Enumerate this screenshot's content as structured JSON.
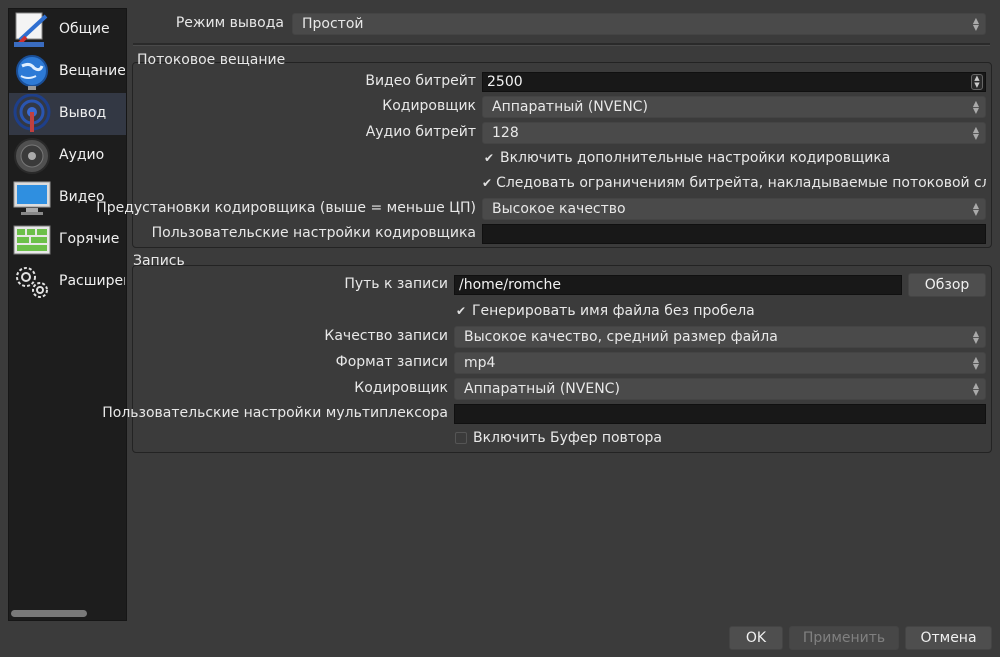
{
  "sidebar": {
    "items": [
      {
        "label": "Общие",
        "icon": "general-settings-icon"
      },
      {
        "label": "Вещание",
        "icon": "stream-globe-icon"
      },
      {
        "label": "Вывод",
        "icon": "output-antenna-icon"
      },
      {
        "label": "Аудио",
        "icon": "speaker-icon"
      },
      {
        "label": "Видео",
        "icon": "monitor-icon"
      },
      {
        "label": "Горячие к...",
        "icon": "keyboard-icon"
      },
      {
        "label": "Расширен...",
        "icon": "gears-icon"
      }
    ],
    "active": "Вывод"
  },
  "output_mode": {
    "label": "Режим вывода",
    "value": "Простой"
  },
  "streaming": {
    "title": "Потоковое вещание",
    "video_bitrate": {
      "label": "Видео битрейт",
      "value": "2500"
    },
    "encoder": {
      "label": "Кодировщик",
      "value": "Аппаратный (NVENC)"
    },
    "audio_bitrate": {
      "label": "Аудио битрейт",
      "value": "128"
    },
    "advanced_check": {
      "label": "Включить дополнительные настройки кодировщика",
      "checked": true
    },
    "enforce_check": {
      "label": "Следовать ограничениям битрейта, накладываемые потоковой службой",
      "checked": true
    },
    "preset": {
      "label": "Предустановки кодировщика (выше = меньше ЦП)",
      "value": "Высокое качество"
    },
    "custom_settings": {
      "label": "Пользовательские настройки кодировщика",
      "value": ""
    }
  },
  "recording": {
    "title": "Запись",
    "path": {
      "label": "Путь к записи",
      "value": "/home/romche",
      "browse": "Обзор"
    },
    "nospace_check": {
      "label": "Генерировать имя файла без пробела",
      "checked": true
    },
    "quality": {
      "label": "Качество записи",
      "value": "Высокое качество, средний размер файла"
    },
    "format": {
      "label": "Формат записи",
      "value": "mp4"
    },
    "encoder": {
      "label": "Кодировщик",
      "value": "Аппаратный (NVENC)"
    },
    "muxer": {
      "label": "Пользовательские настройки мультиплексора",
      "value": ""
    },
    "replay_check": {
      "label": "Включить Буфер повтора",
      "checked": false
    }
  },
  "buttons": {
    "ok": "OK",
    "apply": "Применить",
    "cancel": "Отмена"
  }
}
